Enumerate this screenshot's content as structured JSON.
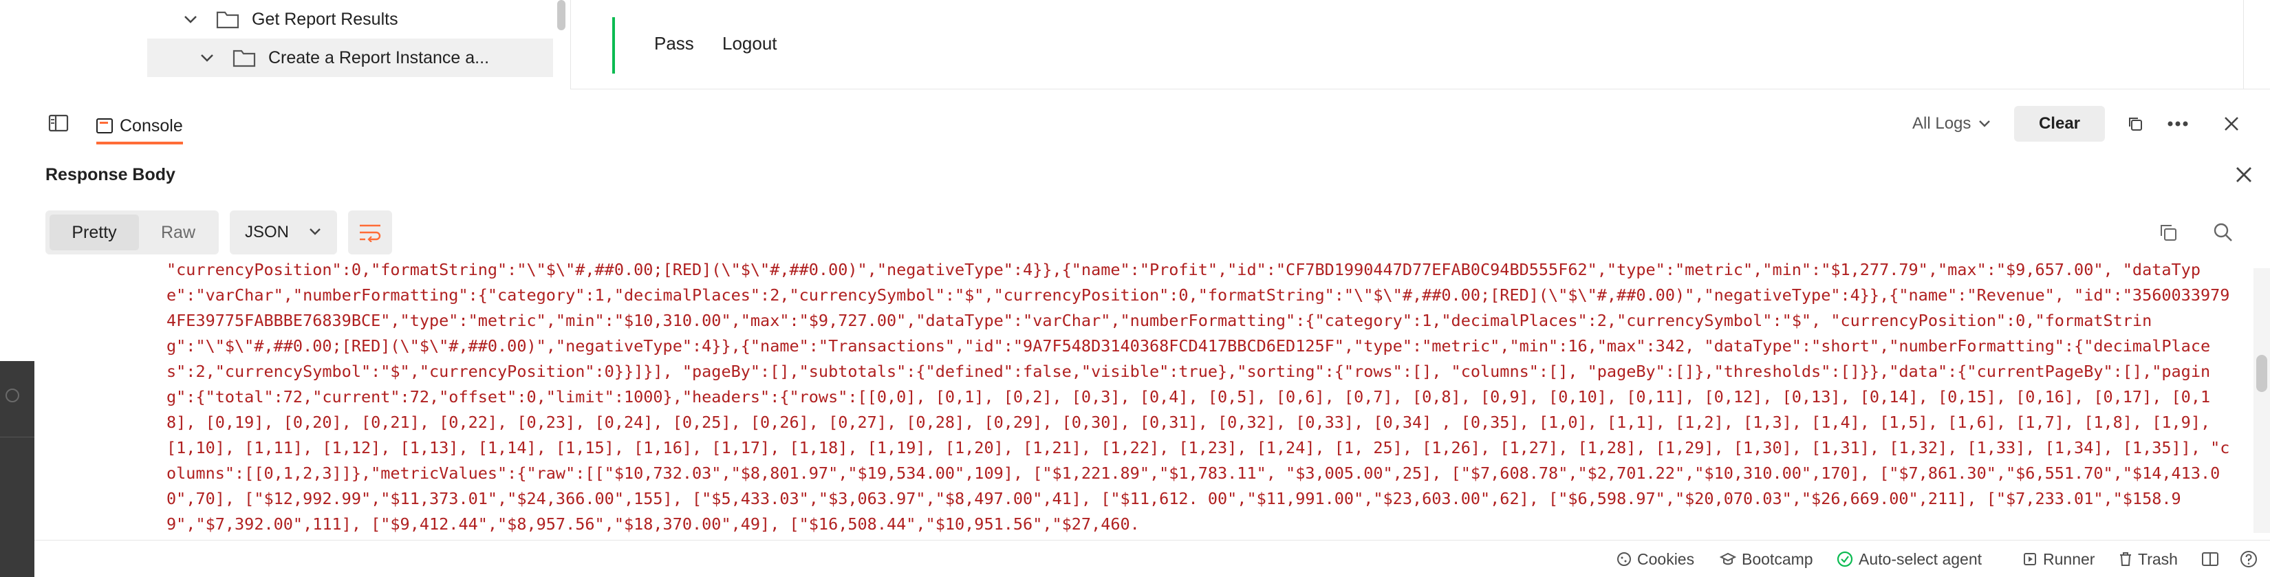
{
  "sidebar": {
    "items": [
      {
        "label": "Get Report Results"
      },
      {
        "label": "Create a Report Instance a..."
      }
    ]
  },
  "request": {
    "links": [
      "Pass",
      "Logout"
    ]
  },
  "console": {
    "tab_label": "Console",
    "log_filter": "All Logs",
    "clear_label": "Clear"
  },
  "response": {
    "title": "Response Body",
    "view_modes": [
      "Pretty",
      "Raw"
    ],
    "format": "JSON",
    "body_text": "\"currencyPosition\":0,\"formatString\":\"\\\"$\\\"#,##0.00;[RED](\\\"$\\\"#,##0.00)\",\"negativeType\":4}},{\"name\":\"Profit\",\"id\":\"CF7BD1990447D77EFAB0C94BD555F62\",\"type\":\"metric\",\"min\":\"$1,277.79\",\"max\":\"$9,657.00\", \"dataType\":\"varChar\",\"numberFormatting\":{\"category\":1,\"decimalPlaces\":2,\"currencySymbol\":\"$\",\"currencyPosition\":0,\"formatString\":\"\\\"$\\\"#,##0.00;[RED](\\\"$\\\"#,##0.00)\",\"negativeType\":4}},{\"name\":\"Revenue\", \"id\":\"35600339794FE39775FABBBE76839BCE\",\"type\":\"metric\",\"min\":\"$10,310.00\",\"max\":\"$9,727.00\",\"dataType\":\"varChar\",\"numberFormatting\":{\"category\":1,\"decimalPlaces\":2,\"currencySymbol\":\"$\", \"currencyPosition\":0,\"formatString\":\"\\\"$\\\"#,##0.00;[RED](\\\"$\\\"#,##0.00)\",\"negativeType\":4}},{\"name\":\"Transactions\",\"id\":\"9A7F548D3140368FCD417BBCD6ED125F\",\"type\":\"metric\",\"min\":16,\"max\":342, \"dataType\":\"short\",\"numberFormatting\":{\"decimalPlaces\":2,\"currencySymbol\":\"$\",\"currencyPosition\":0}}]}], \"pageBy\":[],\"subtotals\":{\"defined\":false,\"visible\":true},\"sorting\":{\"rows\":[], \"columns\":[], \"pageBy\":[]},\"thresholds\":[]}},\"data\":{\"currentPageBy\":[],\"paging\":{\"total\":72,\"current\":72,\"offset\":0,\"limit\":1000},\"headers\":{\"rows\":[[0,0], [0,1], [0,2], [0,3], [0,4], [0,5], [0,6], [0,7], [0,8], [0,9], [0,10], [0,11], [0,12], [0,13], [0,14], [0,15], [0,16], [0,17], [0,18], [0,19], [0,20], [0,21], [0,22], [0,23], [0,24], [0,25], [0,26], [0,27], [0,28], [0,29], [0,30], [0,31], [0,32], [0,33], [0,34] , [0,35], [1,0], [1,1], [1,2], [1,3], [1,4], [1,5], [1,6], [1,7], [1,8], [1,9], [1,10], [1,11], [1,12], [1,13], [1,14], [1,15], [1,16], [1,17], [1,18], [1,19], [1,20], [1,21], [1,22], [1,23], [1,24], [1, 25], [1,26], [1,27], [1,28], [1,29], [1,30], [1,31], [1,32], [1,33], [1,34], [1,35]], \"columns\":[[0,1,2,3]]},\"metricValues\":{\"raw\":[[\"$10,732.03\",\"$8,801.97\",\"$19,534.00\",109], [\"$1,221.89\",\"$1,783.11\", \"$3,005.00\",25], [\"$7,608.78\",\"$2,701.22\",\"$10,310.00\",170], [\"$7,861.30\",\"$6,551.70\",\"$14,413.00\",70], [\"$12,992.99\",\"$11,373.01\",\"$24,366.00\",155], [\"$5,433.03\",\"$3,063.97\",\"$8,497.00\",41], [\"$11,612. 00\",\"$11,991.00\",\"$23,603.00\",62], [\"$6,598.97\",\"$20,070.03\",\"$26,669.00\",211], [\"$7,233.01\",\"$158.99\",\"$7,392.00\",111], [\"$9,412.44\",\"$8,957.56\",\"$18,370.00\",49], [\"$16,508.44\",\"$10,951.56\",\"$27,460."
  },
  "status_bar": {
    "items": [
      "Cookies",
      "Bootcamp",
      "Auto-select agent",
      "Runner",
      "Trash"
    ]
  },
  "colors": {
    "accent": "#ff6c37",
    "pass_bar": "#0cbb52",
    "code_text": "#b02020"
  }
}
